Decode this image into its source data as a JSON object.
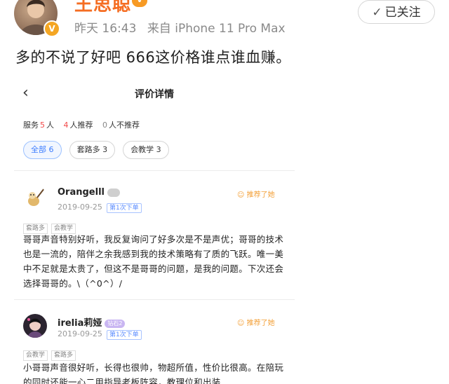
{
  "post": {
    "username": "王思聪",
    "vip_label": "V",
    "verified_label": "V",
    "time": "昨天 16:43",
    "source": "来自 iPhone 11 Pro Max",
    "follow_label": "已关注",
    "text": "多的不说了好吧 666这价格谁点谁血赚。"
  },
  "screenshot": {
    "back_icon": "‹",
    "title": "评价详情",
    "summary": {
      "service_label": "服务",
      "service_count": "5",
      "service_unit": "人",
      "recommend_count": "4",
      "recommend_label": "人推荐",
      "not_recommend_count": "0",
      "not_recommend_label": "人不推荐"
    },
    "filters": [
      {
        "label": "全部 6"
      },
      {
        "label": "套路多 3"
      },
      {
        "label": "会教学 3"
      }
    ],
    "reviews": [
      {
        "name": "Orangelll",
        "badge": "",
        "recommend": "推荐了她",
        "date": "2019-09-25",
        "times": "第1次下单",
        "tags": [
          "套路多",
          "会教学"
        ],
        "text": "哥哥声音特别好听，我反复询问了好多次是不是声优；哥哥的技术也是一流的，陪伴之余我感到我的技术策略有了质的飞跃。唯一美中不足就是太贵了，但这不是哥哥的问题，是我的问题。下次还会选择哥哥的。\\（^0^）/"
      },
      {
        "name": "irelia莉娅",
        "badge": "钻石2",
        "recommend": "推荐了她",
        "date": "2019-09-25",
        "times": "第1次下单",
        "tags": [
          "会教学",
          "套路多"
        ],
        "text": "小哥哥声音很好听，长得也很帅，物超所值，性价比很高。在陪玩的同时还能一心二用指导老板阵容，教理位和出装"
      }
    ]
  }
}
